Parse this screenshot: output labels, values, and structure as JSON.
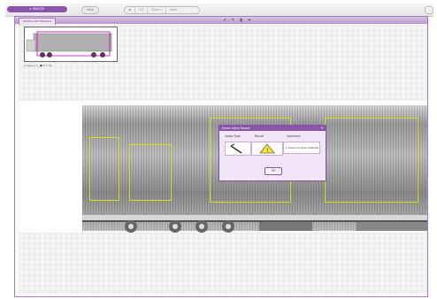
{
  "toolbar": {
    "left_pill": "▸ IMAGES",
    "grey_pill": "Help",
    "segments": [
      "◀",
      "1/3",
      "Scan 1",
      "Next"
    ]
  },
  "tab": {
    "label": "MT-IMG-SET-5500004"
  },
  "thumbnail_tools": {
    "text": "▾ Layers  🔍 ■ ▾  ▭ ▾ ▸"
  },
  "dialog": {
    "title": "Smart Alarm Report",
    "columns": [
      "Cargo Type",
      "Result",
      "Comment"
    ],
    "message": "1 suspicious object detected",
    "ok_label": "OK"
  }
}
